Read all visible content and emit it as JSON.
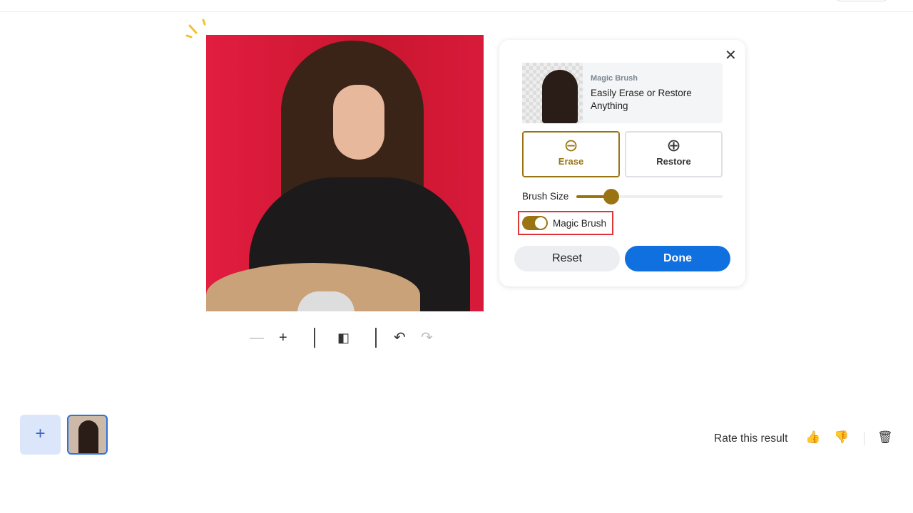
{
  "panel": {
    "promo_kicker": "Magic Brush",
    "promo_desc": "Easily Erase or Restore Anything",
    "erase_label": "Erase",
    "restore_label": "Restore",
    "brush_size_label": "Brush Size",
    "brush_size_percent": 24,
    "magic_brush_label": "Magic Brush",
    "magic_brush_on": true,
    "reset_label": "Reset",
    "done_label": "Done",
    "accent": "#9a7412",
    "primary": "#1070e0"
  },
  "toolbar": {
    "zoom_out": "—",
    "zoom_in": "+",
    "compare": "◧",
    "undo": "↶",
    "redo": "↷"
  },
  "filmstrip": {
    "add": "+"
  },
  "feedback": {
    "rate_label": "Rate this result",
    "thumbs_up": "👍",
    "thumbs_down": "👎",
    "delete": "🗑"
  }
}
